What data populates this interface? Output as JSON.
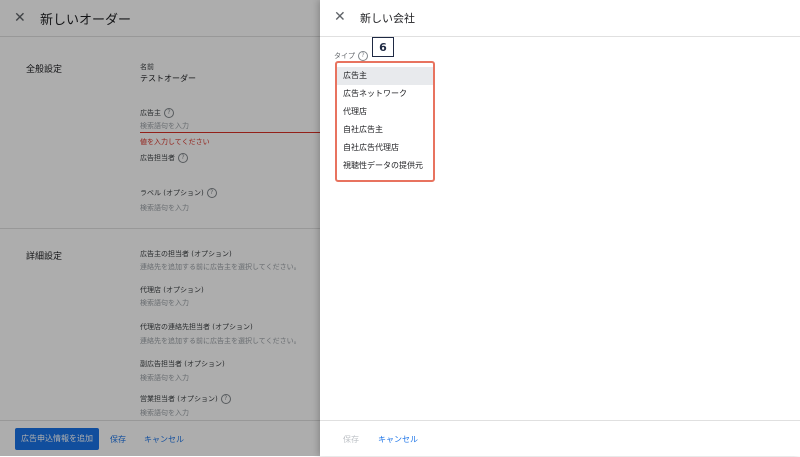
{
  "background_page": {
    "title": "新しいオーダー",
    "sections": {
      "general": "全般設定",
      "details": "詳細設定"
    },
    "fields": {
      "name_label": "名前",
      "name_value": "テストオーダー",
      "advertiser_label": "広告主",
      "advertiser_placeholder": "検索語句を入力",
      "advertiser_error": "値を入力してください",
      "advertiser_contact_label": "広告担当者",
      "labels_label": "ラベル (オプション)",
      "labels_placeholder": "検索語句を入力",
      "adv_contact_opt_label": "広告主の担当者 (オプション)",
      "adv_contact_opt_hint": "連絡先を追加する前に広告主を選択してください。",
      "agency_label": "代理店 (オプション)",
      "agency_placeholder": "検索語句を入力",
      "agency_contact_label": "代理店の連絡先担当者 (オプション)",
      "agency_contact_hint": "連絡先を追加する前に広告主を選択してください。",
      "secondary_trafficker_label": "副広告担当者 (オプション)",
      "secondary_trafficker_placeholder": "検索語句を入力",
      "salesperson_label": "営業担当者 (オプション)",
      "salesperson_placeholder": "検索語句を入力"
    },
    "footer": {
      "primary_button": "広告申込情報を追加",
      "save": "保存",
      "cancel": "キャンセル"
    }
  },
  "panel": {
    "title": "新しい会社",
    "type_label": "タイプ",
    "badge": "6",
    "dropdown_options": [
      "広告主",
      "広告ネットワーク",
      "代理店",
      "自社広告主",
      "自社広告代理店",
      "視聴性データの提供元"
    ],
    "selected_index": 0,
    "footer": {
      "save": "保存",
      "cancel": "キャンセル"
    }
  },
  "icons": {
    "close": "close-icon",
    "help": "help-icon"
  },
  "colors": {
    "accent": "#1a73e8",
    "error": "#d93025",
    "highlight_border": "#e8735f"
  }
}
